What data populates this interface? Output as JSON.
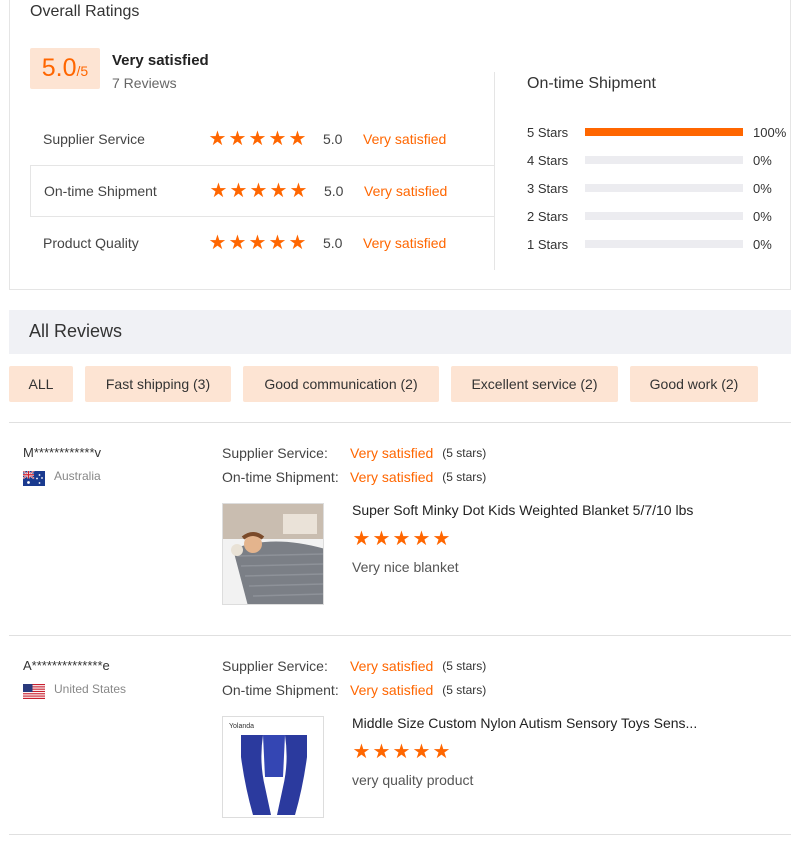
{
  "overall": {
    "title": "Overall Ratings",
    "score": "5.0",
    "score_max": "/5",
    "score_label": "Very satisfied",
    "reviews_count": "7 Reviews",
    "metrics": [
      {
        "name": "Supplier Service",
        "score": "5.0",
        "text": "Very satisfied",
        "stars": 5
      },
      {
        "name": "On-time Shipment",
        "score": "5.0",
        "text": "Very satisfied",
        "stars": 5
      },
      {
        "name": "Product Quality",
        "score": "5.0",
        "text": "Very satisfied",
        "stars": 5
      }
    ]
  },
  "shipment": {
    "title": "On-time Shipment",
    "rows": [
      {
        "label": "5 Stars",
        "percent_text": "100%",
        "fraction": 1.0
      },
      {
        "label": "4 Stars",
        "percent_text": "0%",
        "fraction": 0
      },
      {
        "label": "3 Stars",
        "percent_text": "0%",
        "fraction": 0
      },
      {
        "label": "2 Stars",
        "percent_text": "0%",
        "fraction": 0
      },
      {
        "label": "1 Stars",
        "percent_text": "0%",
        "fraction": 0
      }
    ]
  },
  "all_reviews": {
    "title": "All Reviews",
    "filters": [
      "ALL",
      "Fast shipping (3)",
      "Good communication (2)",
      "Excellent service (2)",
      "Good work (2)"
    ]
  },
  "reviews": [
    {
      "reviewer": "M************v",
      "country": "Australia",
      "flag_icon": "australia-flag-icon",
      "supplier_service_label": "Supplier Service:",
      "supplier_service_value": "Very satisfied",
      "supplier_service_note": "(5 stars)",
      "shipment_label": "On-time Shipment:",
      "shipment_value": "Very satisfied",
      "shipment_note": "(5 stars)",
      "product_title": "Super Soft Minky Dot Kids Weighted Blanket 5/7/10 lbs",
      "product_stars": 5,
      "comment": "Very nice blanket"
    },
    {
      "reviewer": "A**************e",
      "country": "United States",
      "flag_icon": "united-states-flag-icon",
      "supplier_service_label": "Supplier Service:",
      "supplier_service_value": "Very satisfied",
      "supplier_service_note": "(5 stars)",
      "shipment_label": "On-time Shipment:",
      "shipment_value": "Very satisfied",
      "shipment_note": "(5 stars)",
      "product_title": "Middle Size Custom Nylon Autism Sensory Toys Sens...",
      "product_image_text": "Yolanda",
      "product_stars": 5,
      "comment": "very quality product"
    }
  ],
  "colors": {
    "accent": "#ff6600",
    "accent_light": "#fde4d3",
    "bar_track": "#ececf0",
    "header_bg": "#f0f1f5"
  }
}
